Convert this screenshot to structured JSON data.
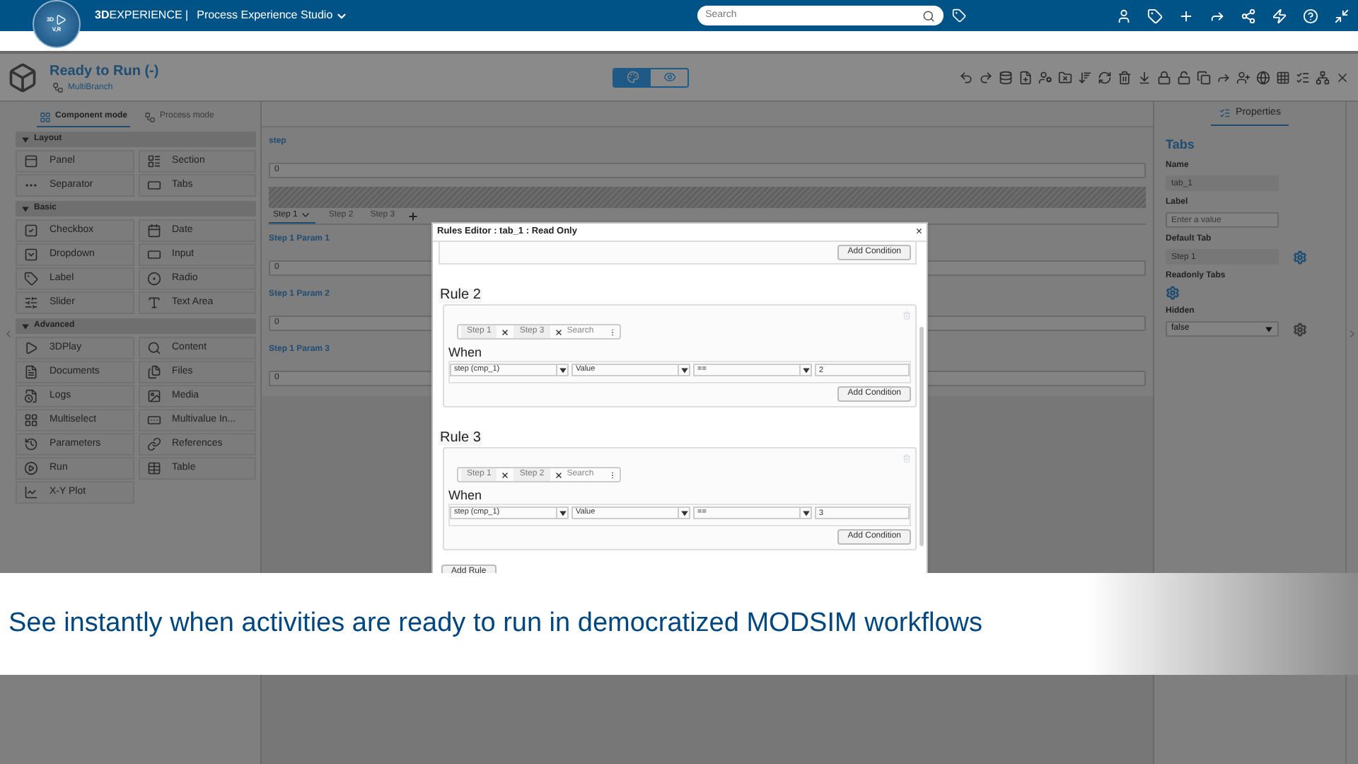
{
  "topbar": {
    "brand": "**3D**EXPERIENCE |",
    "app": "Process Experience Studio",
    "search": {
      "placeholder": "Search"
    },
    "compass": [
      "3D",
      "V,R"
    ]
  },
  "header": {
    "title": "Ready to Run (-)",
    "subtitle": "MultiBranch",
    "view_toggle": [
      {
        "selected": true
      },
      {
        "selected": false
      }
    ]
  },
  "left_panel": {
    "modes": [
      {
        "label": "Component mode",
        "selected": true
      },
      {
        "label": "Process mode",
        "selected": false
      }
    ],
    "sections": [
      {
        "title": "Layout",
        "expanded": true,
        "items": [
          "Panel",
          "Section",
          "Separator",
          "Tabs"
        ]
      },
      {
        "title": "Basic",
        "expanded": true,
        "items": [
          "Checkbox",
          "Date",
          "Dropdown",
          "Input",
          "Label",
          "Radio",
          "Slider",
          "Text Area"
        ]
      },
      {
        "title": "Advanced",
        "expanded": true,
        "items": [
          "3DPlay",
          "Content",
          "Documents",
          "Files",
          "Logs",
          "Media",
          "Multiselect",
          "Multivalue In...",
          "Parameters",
          "References",
          "Run",
          "Table",
          "X-Y Plot"
        ]
      }
    ]
  },
  "canvas": {
    "step_field": {
      "label": "step",
      "value": "0"
    },
    "tabs": [
      {
        "label": "Step 1",
        "selected": true
      },
      {
        "label": "Step 2",
        "selected": false
      },
      {
        "label": "Step 3",
        "selected": false
      }
    ],
    "params": [
      {
        "label": "Step 1 Param 1",
        "value": "0"
      },
      {
        "label": "Step 1 Param 2",
        "value": "0"
      },
      {
        "label": "Step 1 Param 3",
        "value": "0"
      }
    ]
  },
  "properties": {
    "tab": {
      "label": "Properties",
      "selected": true
    },
    "heading": "Tabs",
    "fields": [
      {
        "label": "Name",
        "kind": "text",
        "value": "tab_1",
        "disabled": true,
        "gear": false
      },
      {
        "label": "Label",
        "kind": "text",
        "placeholder": "Enter a value",
        "disabled": false,
        "gear": false
      },
      {
        "label": "Default Tab",
        "kind": "text",
        "value": "Step 1",
        "disabled": true,
        "gear": true
      },
      {
        "label": "Readonly Tabs",
        "kind": "none",
        "gear": true
      },
      {
        "label": "Hidden",
        "kind": "select",
        "value": "false",
        "gear": true
      }
    ]
  },
  "dialog": {
    "title": "Rules Editor : tab_1 : Read Only",
    "close": "×",
    "top_button": "Add Condition",
    "rules": [
      {
        "title": "Rule 2",
        "tags": [
          "Step 1",
          "Step 3"
        ],
        "search_placeholder": "Search",
        "when": "When",
        "condition": {
          "field": "step (cmp_1)",
          "type": "Value",
          "op": "==",
          "value": "2"
        },
        "button": "Add Condition"
      },
      {
        "title": "Rule 3",
        "tags": [
          "Step 1",
          "Step 2"
        ],
        "search_placeholder": "Search",
        "when": "When",
        "condition": {
          "field": "step (cmp_1)",
          "type": "Value",
          "op": "==",
          "value": "3"
        },
        "button": "Add Condition"
      }
    ],
    "add_rule": "Add Rule"
  },
  "caption": "See instantly when activities are ready to run in democratized MODSIM workflows"
}
